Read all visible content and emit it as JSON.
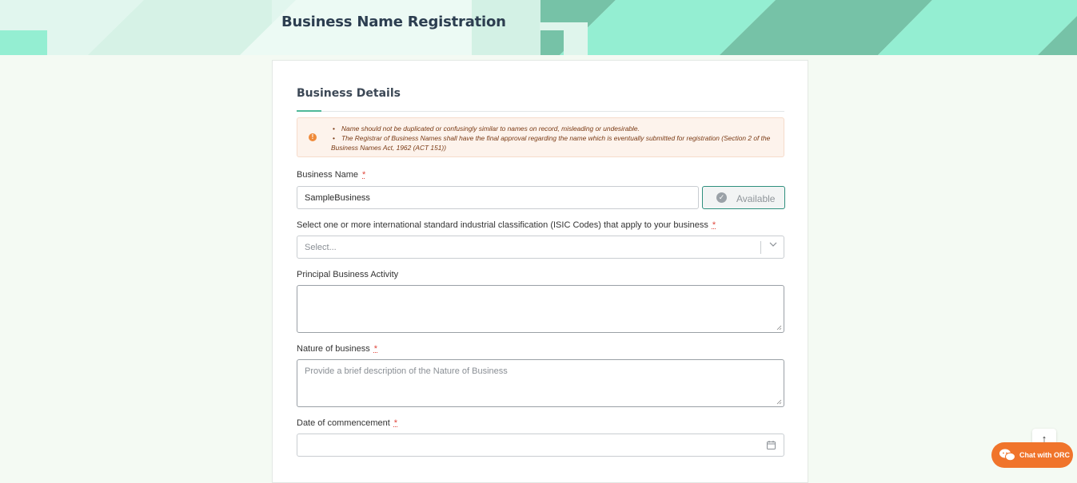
{
  "header": {
    "title": "Business Name Registration"
  },
  "section": {
    "title": "Business Details"
  },
  "notice": {
    "items": [
      "Name should not be duplicated or confusingly similar to names on record, misleading or undesirable.",
      "The Registrar of Business Names shall have the final approval regarding the name which is eventually submitted for registration (Section 2 of the Business Names Act, 1962 (ACT 151))"
    ]
  },
  "form": {
    "business_name": {
      "label": "Business Name",
      "required": "*",
      "value": "SampleBusiness",
      "status": "Available"
    },
    "isic": {
      "label": "Select one or more international standard industrial classification (ISIC Codes) that apply to your business",
      "required": "*",
      "placeholder": "Select..."
    },
    "principal_activity": {
      "label": "Principal Business Activity",
      "value": ""
    },
    "nature": {
      "label": "Nature of business",
      "required": "*",
      "placeholder": "Provide a brief description of the Nature of Business"
    },
    "commencement": {
      "label": "Date of commencement",
      "required": "*",
      "value": ""
    }
  },
  "widgets": {
    "scroll_top": "↑",
    "chat": "Chat with ORC"
  },
  "colors": {
    "accent": "#4fb99a",
    "brand_orange": "#f0742b",
    "banner_teal": "#76c2a7",
    "banner_mint": "#94eed2"
  }
}
